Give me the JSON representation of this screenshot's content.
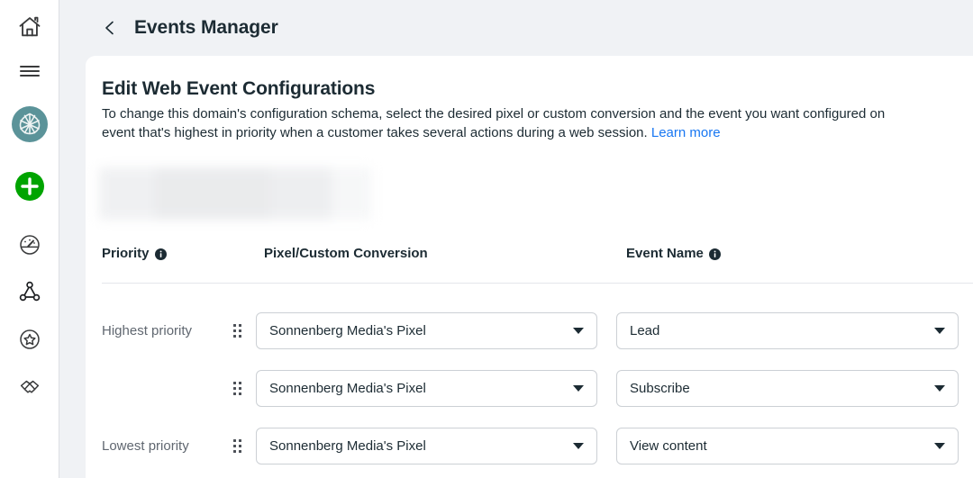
{
  "sidebar": {
    "items": [
      {
        "name": "home-icon",
        "label": "Home"
      },
      {
        "name": "menu-icon",
        "label": "Menu"
      },
      {
        "name": "meta-business-icon",
        "label": "Business Suite",
        "color": "#5b9399"
      },
      {
        "name": "create-icon",
        "label": "Create",
        "color": "#00a400"
      },
      {
        "name": "dashboard-icon",
        "label": "Dashboard"
      },
      {
        "name": "network-icon",
        "label": "Connections"
      },
      {
        "name": "star-circle-icon",
        "label": "Favorites"
      },
      {
        "name": "handshake-icon",
        "label": "Partnerships"
      }
    ]
  },
  "header": {
    "back_label": "Back",
    "title": "Events Manager"
  },
  "main": {
    "title": "Edit Web Event Configurations",
    "description_line1": "To change this domain's configuration schema, select the desired pixel or custom conversion and the event you want configured on",
    "description_line2": "event that's highest in priority when a customer takes several actions during a web session.",
    "learn_more_label": "Learn more",
    "table": {
      "headers": {
        "priority": "Priority",
        "pixel": "Pixel/Custom Conversion",
        "event": "Event Name"
      },
      "rows": [
        {
          "priority_label": "Highest priority",
          "pixel_value": "Sonnenberg Media's Pixel",
          "event_value": "Lead"
        },
        {
          "priority_label": "",
          "pixel_value": "Sonnenberg Media's Pixel",
          "event_value": "Subscribe"
        },
        {
          "priority_label": "Lowest priority",
          "pixel_value": "Sonnenberg Media's Pixel",
          "event_value": "View content"
        }
      ]
    }
  },
  "colors": {
    "link": "#1877f2",
    "page_bg": "#f0f2f5",
    "text": "#1c2b33",
    "muted_text": "#606770",
    "border": "#ccd0d5"
  }
}
